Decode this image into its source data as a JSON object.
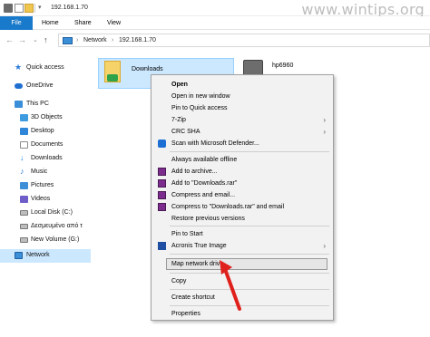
{
  "titlebar": {
    "path": "192.168.1.70",
    "watermark": "www.wintips.org"
  },
  "ribbon": {
    "tabs": [
      "File",
      "Home",
      "Share",
      "View"
    ]
  },
  "address": {
    "segments": [
      "Network",
      "192.168.1.70"
    ]
  },
  "sidebar": {
    "items": [
      {
        "label": "Quick access",
        "icon": "star-icon",
        "color": "#2d7cd6"
      },
      {
        "label": "OneDrive",
        "icon": "cloud-icon",
        "color": "#1f6fd1"
      },
      {
        "label": "This PC",
        "icon": "computer-icon",
        "color": "#3b8ed8"
      },
      {
        "label": "3D Objects",
        "icon": "cube-icon",
        "color": "#3e9be0"
      },
      {
        "label": "Desktop",
        "icon": "desktop-icon",
        "color": "#2f86d8"
      },
      {
        "label": "Documents",
        "icon": "documents-icon",
        "color": "#8a8a8a"
      },
      {
        "label": "Downloads",
        "icon": "download-icon",
        "color": "#2a84e0"
      },
      {
        "label": "Music",
        "icon": "music-icon",
        "color": "#2f7ed6"
      },
      {
        "label": "Pictures",
        "icon": "pictures-icon",
        "color": "#3e8fd8"
      },
      {
        "label": "Videos",
        "icon": "videos-icon",
        "color": "#6d5fc7"
      },
      {
        "label": "Local Disk (C:)",
        "icon": "drive-icon",
        "color": "#888888"
      },
      {
        "label": "Δεσμευμένο από τ",
        "icon": "drive-icon",
        "color": "#888888"
      },
      {
        "label": "New Volume (G:)",
        "icon": "drive-icon",
        "color": "#888888"
      },
      {
        "label": "Network",
        "icon": "network-icon",
        "color": "#3a8fd8"
      }
    ]
  },
  "content": {
    "folder_label": "Downloads",
    "printer_label": "hp6960"
  },
  "context_menu": {
    "items": [
      {
        "label": "Open",
        "bold": true
      },
      {
        "label": "Open in new window"
      },
      {
        "label": "Pin to Quick access"
      },
      {
        "label": "7-Zip",
        "submenu": true
      },
      {
        "label": "CRC SHA",
        "submenu": true
      },
      {
        "label": "Scan with Microsoft Defender...",
        "icon": "defender-icon"
      },
      {
        "label": "Always available offline"
      },
      {
        "label": "Add to archive...",
        "icon": "winrar-icon"
      },
      {
        "label": "Add to \"Downloads.rar\"",
        "icon": "winrar-icon"
      },
      {
        "label": "Compress and email...",
        "icon": "winrar-icon"
      },
      {
        "label": "Compress to \"Downloads.rar\" and email",
        "icon": "winrar-icon"
      },
      {
        "label": "Restore previous versions"
      },
      {
        "label": "Pin to Start"
      },
      {
        "label": "Acronis True Image",
        "submenu": true,
        "icon": "acronis-icon"
      },
      {
        "label": "Map network drive..."
      },
      {
        "label": "Copy"
      },
      {
        "label": "Create shortcut"
      },
      {
        "label": "Properties"
      }
    ]
  }
}
